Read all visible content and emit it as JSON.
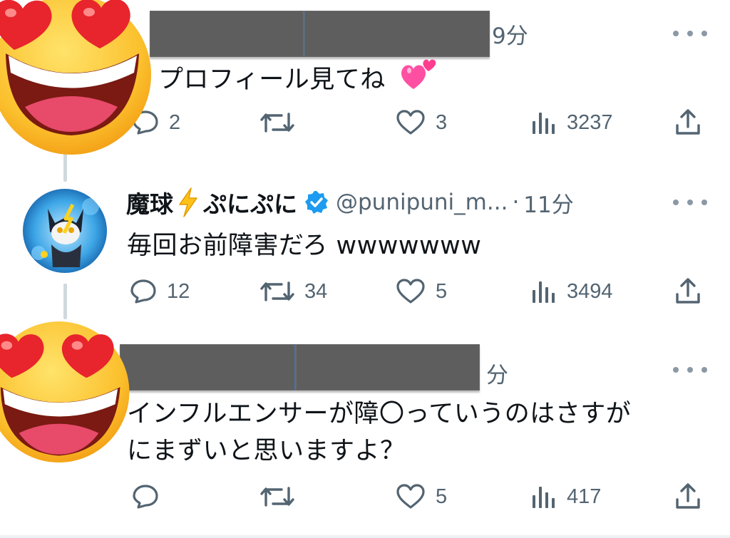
{
  "tweets": [
    {
      "time": "9分",
      "text": "プロフィール見てね",
      "actions": {
        "reply": "2",
        "retweet": "",
        "like": "3",
        "views": "3237"
      }
    },
    {
      "display_name": "魔球",
      "display_name_suffix": "ぷにぷに",
      "handle": "@punipuni_m...",
      "separator": "·",
      "time": "11分",
      "text": "毎回お前障害だろ wwwwwww",
      "actions": {
        "reply": "12",
        "retweet": "34",
        "like": "5",
        "views": "3494"
      }
    },
    {
      "time": "分",
      "text_line1": "インフルエンサーが障〇っていうのはさすが",
      "text_line2": "にまずいと思いますよ？",
      "actions": {
        "reply": "",
        "retweet": "",
        "like": "5",
        "views": "417"
      }
    }
  ],
  "icons": {
    "reply": "reply-bubble-icon",
    "retweet": "retweet-arrows-icon",
    "like": "heart-outline-icon",
    "views": "view-count-bars-icon",
    "share": "share-upload-icon",
    "more": "more-dots-icon",
    "verified": "verified-badge-icon",
    "lightning": "lightning-bolt-emoji",
    "heart_eyes": "heart-eyes-emoji",
    "pink_hearts": "two-hearts-emoji"
  },
  "colors": {
    "text_primary": "#0f1419",
    "text_secondary": "#536471",
    "verified_blue": "#1d9bf0",
    "thread_line": "#cfd9de",
    "redaction": "#5e5e5e"
  }
}
